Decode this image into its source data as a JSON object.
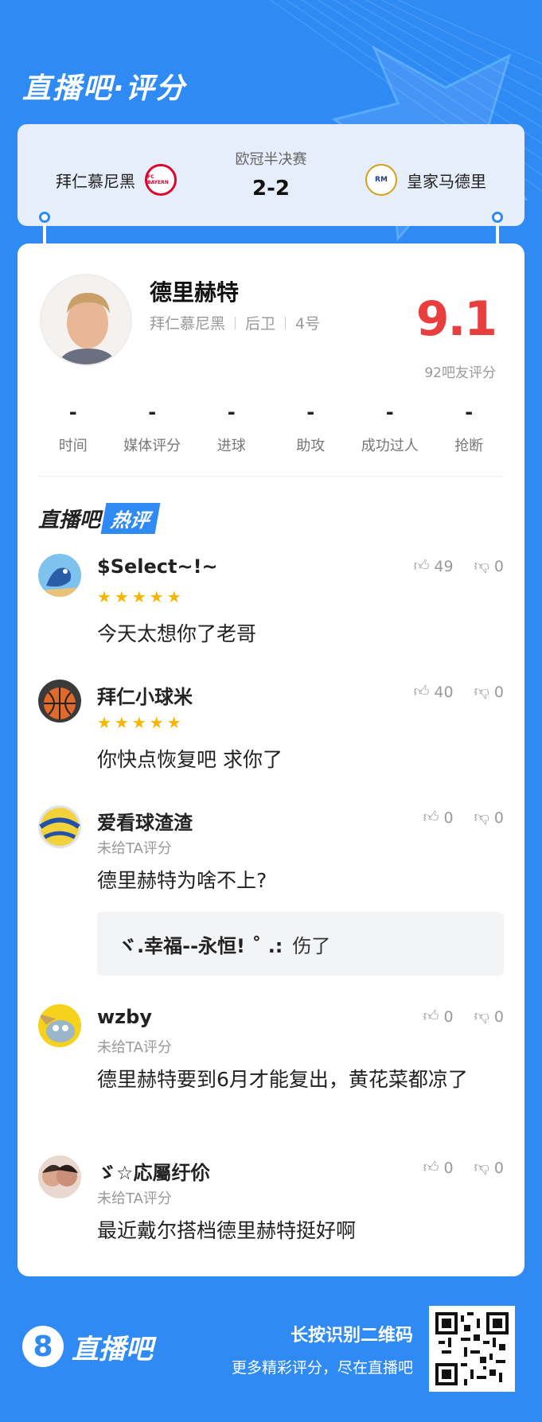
{
  "header": {
    "title": "直播吧·评分"
  },
  "match": {
    "home_team": "拜仁慕尼黑",
    "away_team": "皇家马德里",
    "stage": "欧冠半决赛",
    "score": "2-2",
    "home_badge_text": "FC BAYERN",
    "away_badge_text": "RM"
  },
  "player": {
    "name": "德里赫特",
    "team": "拜仁慕尼黑",
    "position": "后卫",
    "number": "4号",
    "rating": "9.1",
    "rating_count": "92吧友评分"
  },
  "stats": [
    {
      "label": "时间",
      "value": "-"
    },
    {
      "label": "媒体评分",
      "value": "-"
    },
    {
      "label": "进球",
      "value": "-"
    },
    {
      "label": "助攻",
      "value": "-"
    },
    {
      "label": "成功过人",
      "value": "-"
    },
    {
      "label": "抢断",
      "value": "-"
    }
  ],
  "hot_comments": {
    "title_part1": "直播吧",
    "title_part2": "热评",
    "items": [
      {
        "user": "$Select~!~",
        "likes": "49",
        "dislikes": "0",
        "stars": "★★★★★",
        "rating_note": "",
        "text": "今天太想你了老哥",
        "avatar": "parrot"
      },
      {
        "user": "拜仁小球米",
        "likes": "40",
        "dislikes": "0",
        "stars": "★★★★★",
        "rating_note": "",
        "text": "你快点恢复吧 求你了",
        "avatar": "basketball"
      },
      {
        "user": "爱看球渣渣",
        "likes": "0",
        "dislikes": "0",
        "stars": "",
        "rating_note": "未给TA评分",
        "text": "德里赫特为啥不上?",
        "avatar": "volleyball",
        "reply_user": "ヾ.幸福--永恒! ˚ .:",
        "reply_text": "伤了"
      },
      {
        "user": "wzby",
        "likes": "0",
        "dislikes": "0",
        "stars": "",
        "rating_note": "未给TA评分",
        "text": "德里赫特要到6月才能复出，黄花菜都凉了",
        "avatar": "cartoon"
      },
      {
        "user": "ゞ☆応屬纡伱",
        "likes": "0",
        "dislikes": "0",
        "stars": "",
        "rating_note": "未给TA评分",
        "text": "最近戴尔搭档德里赫特挺好啊",
        "avatar": "couple"
      }
    ]
  },
  "footer": {
    "logo_mark": "8",
    "logo_text": "直播吧",
    "line1": "长按识别二维码",
    "line2": "更多精彩评分，尽在直播吧"
  },
  "colors": {
    "brand": "#2f8af4",
    "rating": "#e83e3e",
    "star": "#f7b500"
  }
}
